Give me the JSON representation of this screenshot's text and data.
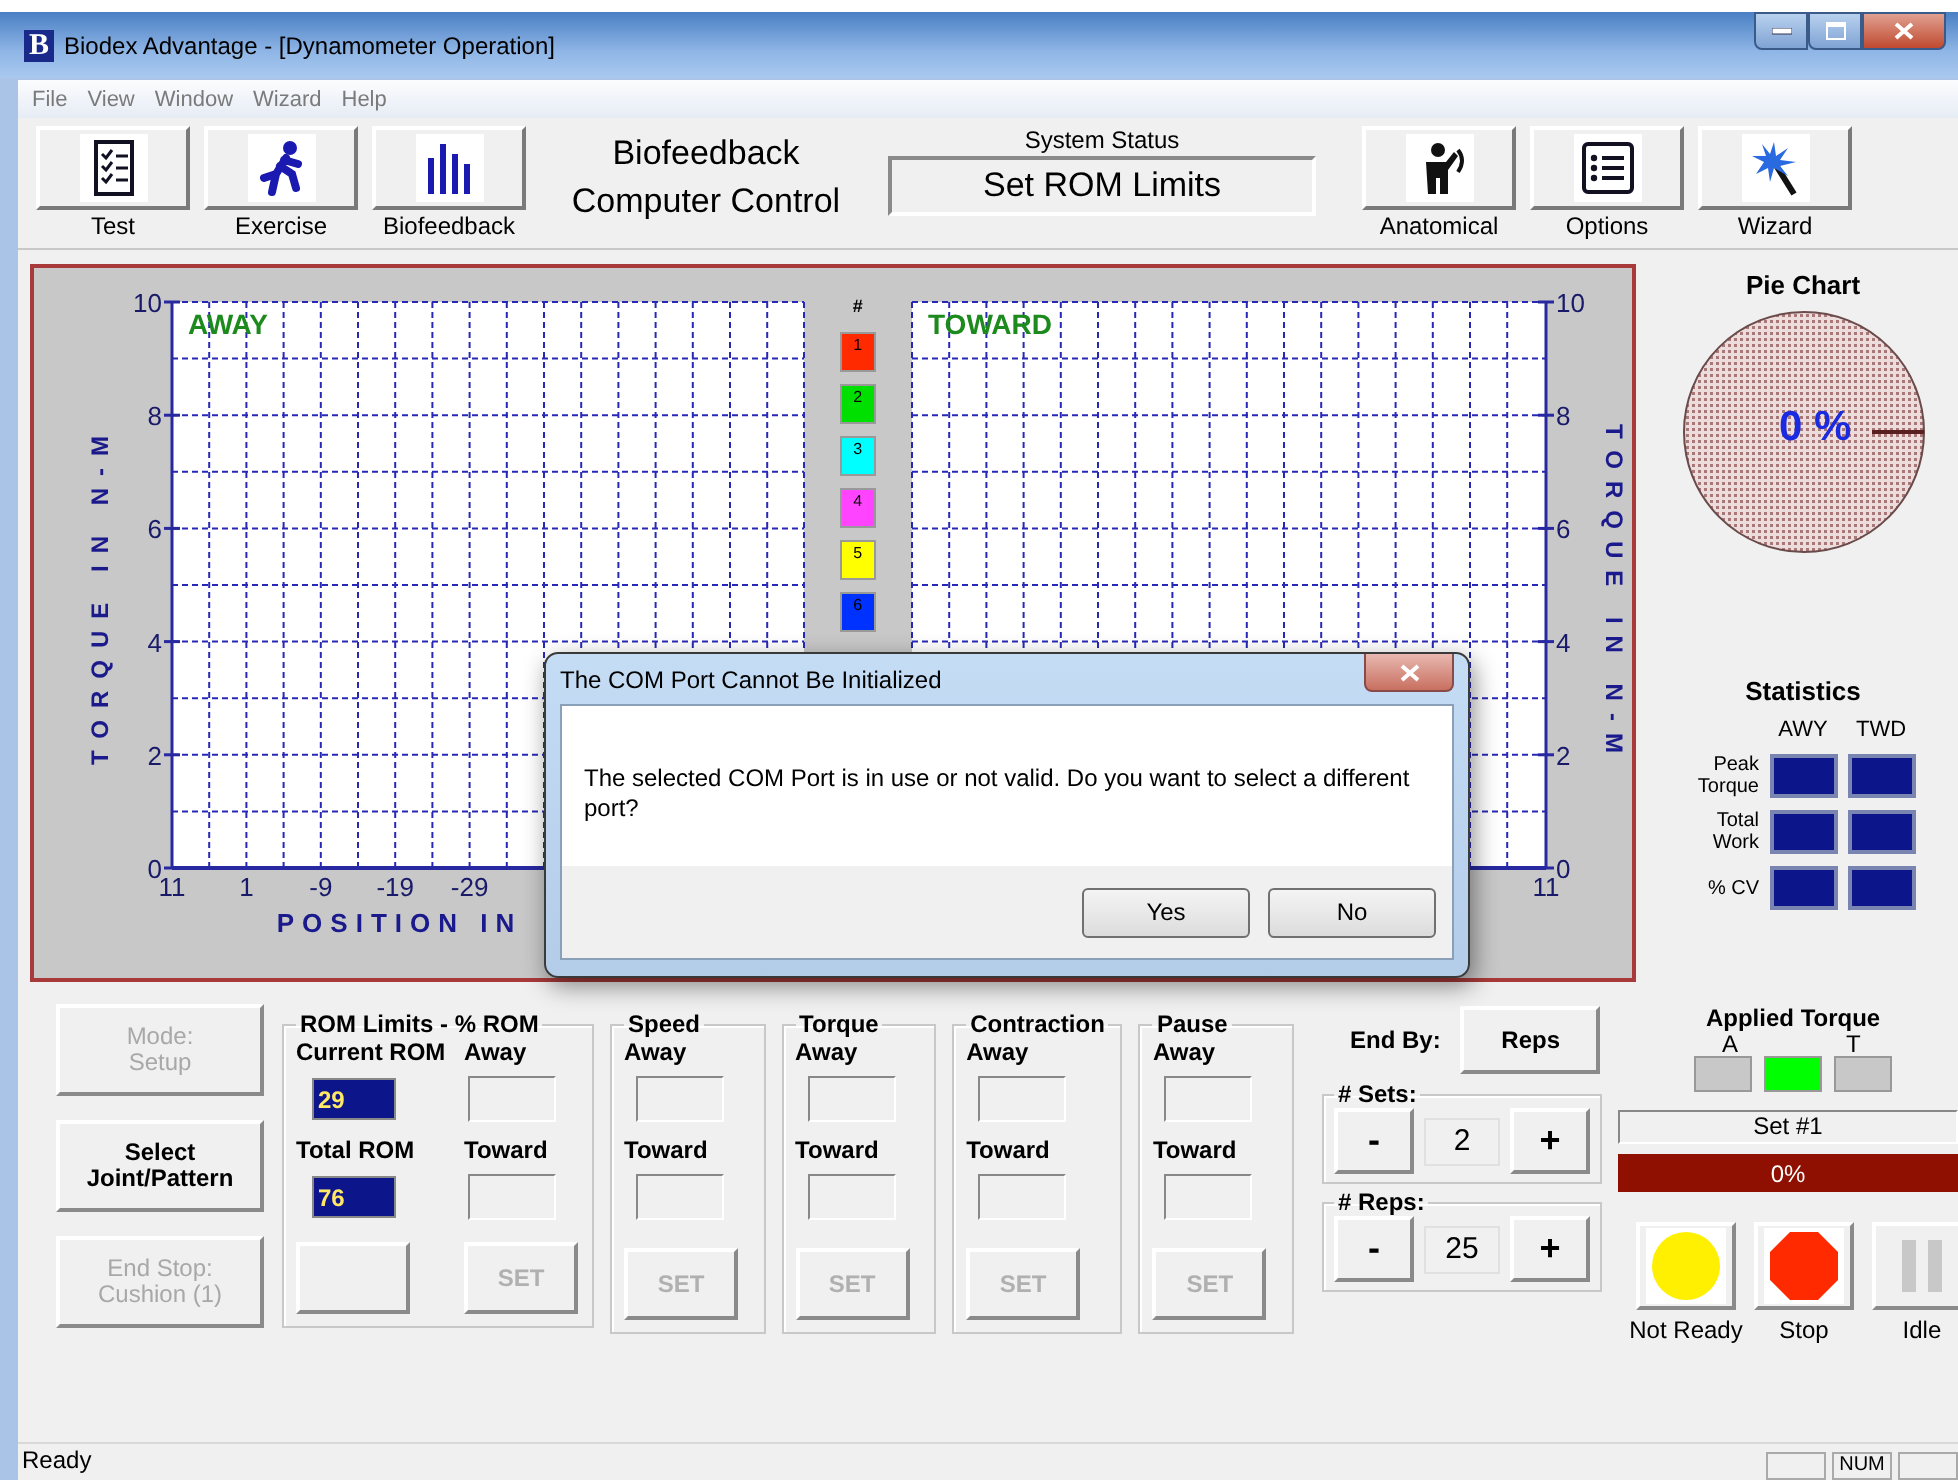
{
  "window": {
    "icon_letter": "B",
    "title": "Biodex Advantage - [Dynamometer Operation]"
  },
  "menu": [
    {
      "label": "File"
    },
    {
      "label": "View"
    },
    {
      "label": "Window"
    },
    {
      "label": "Wizard"
    },
    {
      "label": "Help"
    }
  ],
  "toolbar": {
    "left": [
      {
        "label": "Test"
      },
      {
        "label": "Exercise"
      },
      {
        "label": "Biofeedback"
      }
    ],
    "mode_title": [
      "Biofeedback",
      "Computer Control"
    ],
    "system_status": {
      "label": "System Status",
      "value": "Set ROM Limits"
    },
    "right": [
      {
        "label": "Anatomical"
      },
      {
        "label": "Options"
      },
      {
        "label": "Wizard"
      }
    ]
  },
  "graphs": {
    "away": {
      "label": "AWAY",
      "y_title": "TORQUE IN N-M",
      "y_ticks": [
        "10",
        "8",
        "6",
        "4",
        "2",
        "0"
      ],
      "x_ticks": [
        "11",
        "1",
        "-9",
        "-19",
        "-29"
      ],
      "x_title": "POSITION IN"
    },
    "legend": {
      "header": "#",
      "items": [
        {
          "label": "1",
          "color": "#ff2a00"
        },
        {
          "label": "2",
          "color": "#00e000"
        },
        {
          "label": "3",
          "color": "#00ffff"
        },
        {
          "label": "4",
          "color": "#ff44ff"
        },
        {
          "label": "5",
          "color": "#ffff00"
        },
        {
          "label": "6",
          "color": "#0032ff"
        }
      ]
    },
    "toward": {
      "label": "TOWARD",
      "y_title": "TORQUE IN N-M",
      "y_ticks": [
        "10",
        "8",
        "6",
        "4",
        "2",
        "0"
      ],
      "x_ticks": [
        "11"
      ]
    }
  },
  "pie_chart": {
    "title": "Pie Chart",
    "value": "0 %"
  },
  "statistics": {
    "title": "Statistics",
    "columns": [
      "AWY",
      "TWD"
    ],
    "rows": [
      {
        "label": "Peak Torque"
      },
      {
        "label": "Total Work"
      },
      {
        "label": "% CV"
      }
    ]
  },
  "mode_buttons": [
    {
      "lines": [
        "Mode:",
        "Setup"
      ],
      "disabled": true
    },
    {
      "lines": [
        "Select",
        "Joint/Pattern"
      ],
      "disabled": false
    },
    {
      "lines": [
        "End Stop:",
        "Cushion (1)"
      ],
      "disabled": true
    }
  ],
  "rom_limits": {
    "title": "ROM Limits - % ROM",
    "current_label": "Current ROM",
    "current_value": "29",
    "total_label": "Total ROM",
    "total_value": "76",
    "away_label": "Away",
    "toward_label": "Toward",
    "set_label": "SET",
    "set_disabled": true
  },
  "parameter_groups": [
    {
      "title": "Speed",
      "away_label": "Away",
      "toward_label": "Toward",
      "set_label": "SET",
      "set_disabled": true
    },
    {
      "title": "Torque",
      "away_label": "Away",
      "toward_label": "Toward",
      "set_label": "SET",
      "set_disabled": true
    },
    {
      "title": "Contraction",
      "away_label": "Away",
      "toward_label": "Toward",
      "set_label": "SET",
      "set_disabled": true
    },
    {
      "title": "Pause",
      "away_label": "Away",
      "toward_label": "Toward",
      "set_label": "SET",
      "set_disabled": true
    }
  ],
  "end_by": {
    "label": "End By:",
    "button": "Reps"
  },
  "counters": [
    {
      "title": "# Sets:",
      "minus": "-",
      "value": "2",
      "plus": "+"
    },
    {
      "title": "# Reps:",
      "minus": "-",
      "value": "25",
      "plus": "+"
    }
  ],
  "applied_torque": {
    "title": "Applied Torque",
    "labels": [
      "A",
      "T"
    ],
    "indicators": [
      {
        "on": false
      },
      {
        "on": true
      },
      {
        "on": false
      }
    ]
  },
  "set_display": "Set #1",
  "progress": {
    "label": "0%",
    "level": 0
  },
  "run_buttons": [
    {
      "label": "Not Ready",
      "kind": "ready",
      "disabled": false
    },
    {
      "label": "Stop",
      "kind": "stop",
      "disabled": false
    },
    {
      "label": "Idle",
      "kind": "idle",
      "disabled": true
    }
  ],
  "status_bar": {
    "text": "Ready",
    "num": "NUM"
  },
  "dialog": {
    "title": "The COM Port Cannot Be Initialized",
    "message": "The selected COM Port is in use or not valid. Do you want to select a different port?",
    "buttons": [
      {
        "label": "Yes"
      },
      {
        "label": "No"
      }
    ]
  }
}
